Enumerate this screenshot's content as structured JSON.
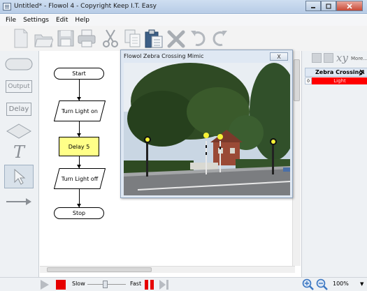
{
  "window": {
    "title": "Untitled* - Flowol 4 - Copyright Keep I.T. Easy"
  },
  "menu": {
    "items": [
      "File",
      "Settings",
      "Edit",
      "Help"
    ]
  },
  "palette": {
    "output_label": "Output",
    "delay_label": "Delay",
    "text_tool": "T"
  },
  "flowchart": {
    "start": "Start",
    "light_on": "Turn Light on",
    "delay": "Delay 5",
    "light_off": "Turn Light off",
    "stop": "Stop"
  },
  "mimic": {
    "title": "Flowol Zebra Crossing Mimic",
    "close_label": "X"
  },
  "right_panel": {
    "xy_label": "xy",
    "more_label": "More...",
    "header_title": "Zebra Crossing",
    "row_index": "0",
    "row_value": "Light",
    "row_color": "#ff0000"
  },
  "bottom": {
    "slow_label": "Slow",
    "fast_label": "Fast",
    "zoom_label": "100%"
  },
  "colors": {
    "delay_fill": "#ffff88",
    "stop_red": "#e60000",
    "accent_blue": "#3a76c2"
  }
}
